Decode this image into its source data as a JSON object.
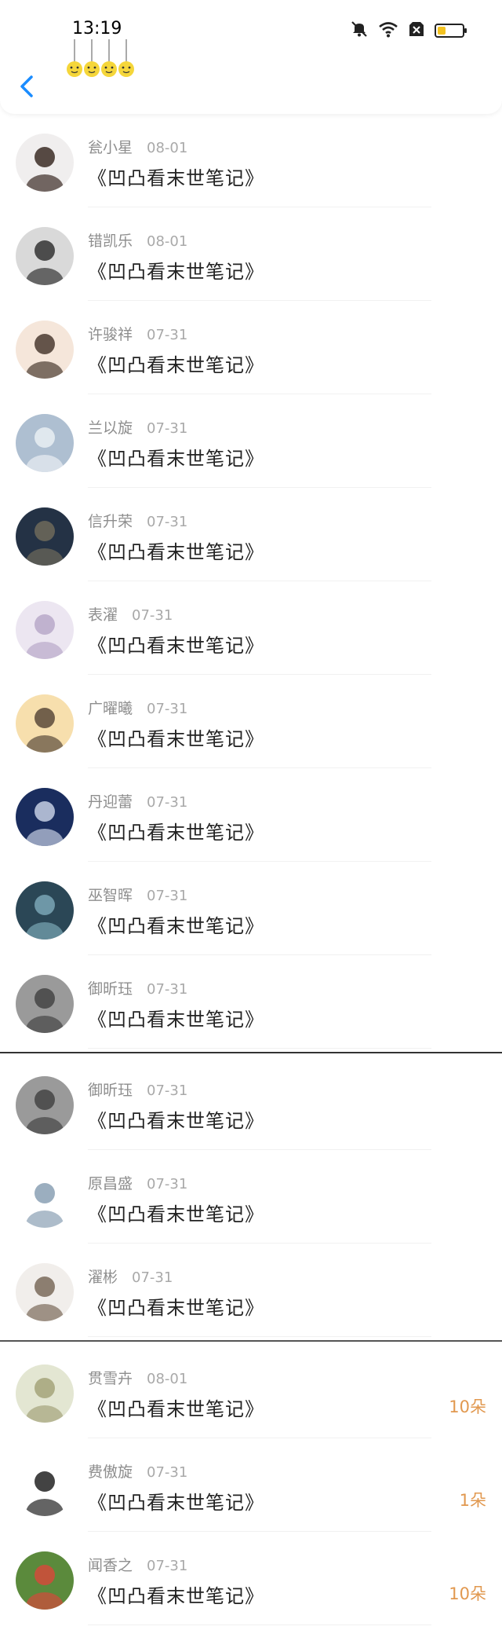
{
  "status_bar": {
    "time": "13:19"
  },
  "header": {
    "back_icon": "chevron-left-icon"
  },
  "colors": {
    "accent": "#1a8cff",
    "amount": "#e1984f"
  },
  "groups": [
    {
      "items": [
        {
          "name": "瓮小星",
          "date": "08-01",
          "title": "《凹凸看末世笔记》",
          "avatar": {
            "bg": "#f0eeee",
            "fg": "#3b2b25"
          }
        },
        {
          "name": "错凯乐",
          "date": "08-01",
          "title": "《凹凸看末世笔记》",
          "avatar": {
            "bg": "#d9d9d9",
            "fg": "#333333"
          }
        },
        {
          "name": "许骏祥",
          "date": "07-31",
          "title": "《凹凸看末世笔记》",
          "avatar": {
            "bg": "#f5e6da",
            "fg": "#4a3a30"
          }
        },
        {
          "name": "兰以旋",
          "date": "07-31",
          "title": "《凹凸看末世笔记》",
          "avatar": {
            "bg": "#aebfd1",
            "fg": "#e9eef3"
          }
        },
        {
          "name": "信升荣",
          "date": "07-31",
          "title": "《凹凸看末世笔记》",
          "avatar": {
            "bg": "#243245",
            "fg": "#6f6a5b"
          }
        },
        {
          "name": "表濯",
          "date": "07-31",
          "title": "《凹凸看末世笔记》",
          "avatar": {
            "bg": "#ece6f1",
            "fg": "#b9a8c9"
          }
        },
        {
          "name": "广曜曦",
          "date": "07-31",
          "title": "《凹凸看末世笔记》",
          "avatar": {
            "bg": "#f7dfad",
            "fg": "#5a4a3a"
          }
        },
        {
          "name": "丹迎蕾",
          "date": "07-31",
          "title": "《凹凸看末世笔记》",
          "avatar": {
            "bg": "#1a2d5e",
            "fg": "#c6cfe3"
          }
        },
        {
          "name": "巫智晖",
          "date": "07-31",
          "title": "《凹凸看末世笔记》",
          "avatar": {
            "bg": "#2b4756",
            "fg": "#7aa6b5"
          }
        },
        {
          "name": "御昕珏",
          "date": "07-31",
          "title": "《凹凸看末世笔记》",
          "avatar": {
            "bg": "#9a9a9a",
            "fg": "#444444"
          }
        }
      ]
    },
    {
      "items": [
        {
          "name": "御昕珏",
          "date": "07-31",
          "title": "《凹凸看末世笔记》",
          "avatar": {
            "bg": "#9a9a9a",
            "fg": "#444444"
          }
        },
        {
          "name": "原昌盛",
          "date": "07-31",
          "title": "《凹凸看末世笔记》",
          "avatar": {
            "bg": "#ffffff",
            "fg": "#8aa0b4"
          }
        },
        {
          "name": "濯彬",
          "date": "07-31",
          "title": "《凹凸看末世笔记》",
          "avatar": {
            "bg": "#f1eeeb",
            "fg": "#7a6a5a"
          }
        }
      ]
    },
    {
      "items": [
        {
          "name": "贯雪卉",
          "date": "08-01",
          "title": "《凹凸看末世笔记》",
          "amount": "10朵",
          "avatar": {
            "bg": "#e3e6d2",
            "fg": "#a4a37a"
          }
        },
        {
          "name": "费傲旋",
          "date": "07-31",
          "title": "《凹凸看末世笔记》",
          "amount": "1朵",
          "avatar": {
            "bg": "#ffffff",
            "fg": "#222222"
          }
        },
        {
          "name": "闻香之",
          "date": "07-31",
          "title": "《凹凸看末世笔记》",
          "amount": "10朵",
          "avatar": {
            "bg": "#5b8a3c",
            "fg": "#d34a3a"
          }
        }
      ]
    }
  ]
}
